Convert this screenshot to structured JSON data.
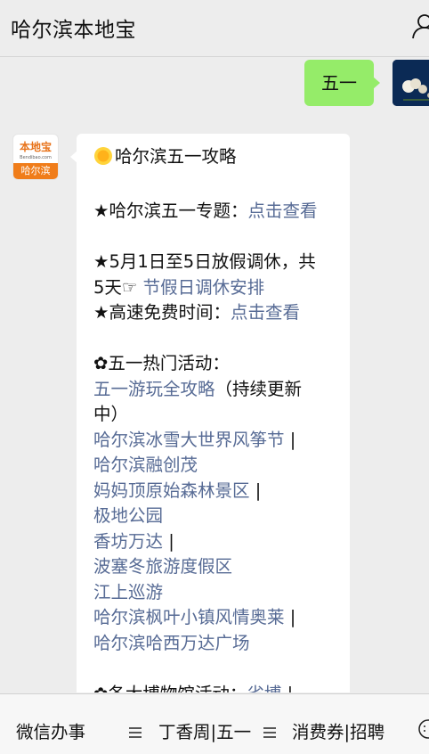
{
  "header": {
    "title": "哈尔滨本地宝"
  },
  "chat": {
    "my_message": "五一",
    "bot_logo": {
      "top_text": "本地宝",
      "url_text": "Bendibao.com",
      "band_text": "哈尔滨"
    },
    "reply": {
      "title": "哈尔滨五一攻略",
      "topic_prefix": "★哈尔滨五一专题：",
      "topic_link": "点击查看",
      "holiday_line1": "★5月1日至5日放假调休，共",
      "holiday_prefix": "5天☞ ",
      "holiday_link": "节假日调休安排",
      "highway_prefix": "★高速免费时间：",
      "highway_link": "点击查看",
      "hot_heading": "✿五一热门活动：",
      "guide_link": "五一游玩全攻略",
      "guide_suffix_a": "（持续更新",
      "guide_suffix_b": "中）",
      "activities": [
        {
          "text": "哈尔滨冰雪大世界风筝节",
          "sep": "|"
        },
        {
          "text": "哈尔滨融创茂",
          "sep": ""
        },
        {
          "text": "妈妈顶原始森林景区",
          "sep": "|"
        },
        {
          "text": "极地公园",
          "sep": ""
        },
        {
          "text": "香坊万达",
          "sep": "|"
        },
        {
          "text": "波塞冬旅游度假区",
          "sep": ""
        },
        {
          "text": "江上巡游",
          "sep": ""
        },
        {
          "text": "哈尔滨枫叶小镇风情奥莱",
          "sep": "|"
        },
        {
          "text": "哈尔滨哈西万达广场",
          "sep": ""
        }
      ],
      "museum_prefix": "✿各大博物馆活动：",
      "museum_link": "省博",
      "museum_sep": "|"
    }
  },
  "bottom_menu": [
    {
      "label": "微信办事",
      "icon": "menu-icon"
    },
    {
      "label": "丁香周|五一",
      "icon": "menu-icon"
    },
    {
      "label": "消费券|招聘",
      "icon": "keyboard-icon"
    }
  ],
  "colors": {
    "bubble_me": "#95ec69",
    "link": "#576b95",
    "brand_orange": "#f07d1a"
  }
}
